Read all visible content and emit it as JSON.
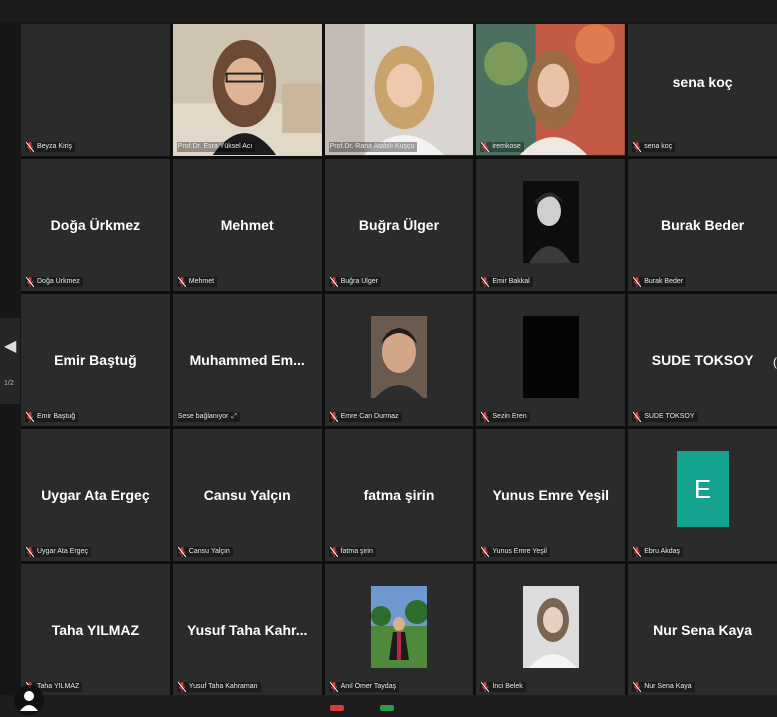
{
  "meeting": {
    "page_indicator": "1/2",
    "colors": {
      "active_border": "#d9e56a",
      "tile_bg": "#2b2b2b",
      "mic_red": "#d83b3b",
      "avatar_teal": "#14a38f"
    }
  },
  "participants": [
    {
      "id": "p1",
      "display": "",
      "label": "Beyza Kiriş",
      "type": "blank"
    },
    {
      "id": "p2",
      "display": "",
      "label": "Prof.Dr. Esra Yüksel Acı",
      "type": "video"
    },
    {
      "id": "p3",
      "display": "",
      "label": "Prof.Dr. Rana Atabilı Kuşçu",
      "type": "video"
    },
    {
      "id": "p4",
      "display": "",
      "label": "iremkose",
      "type": "video"
    },
    {
      "id": "p5",
      "display": "sena koç",
      "label": "sena koç",
      "type": "name"
    },
    {
      "id": "p6",
      "display": "Doğa Ürkmez",
      "label": "Doğa Ürkmez",
      "type": "name"
    },
    {
      "id": "p7",
      "display": "Mehmet",
      "label": "Mehmet",
      "type": "name"
    },
    {
      "id": "p8",
      "display": "Buğra Ülger",
      "label": "Buğra Ülger",
      "type": "name"
    },
    {
      "id": "p9",
      "display": "",
      "label": "Emir Bakkal",
      "type": "photo"
    },
    {
      "id": "p10",
      "display": "Burak Beder",
      "label": "Burak Beder",
      "type": "name"
    },
    {
      "id": "p11",
      "display": "Emir Baştuğ",
      "label": "Emir Baştuğ",
      "type": "name"
    },
    {
      "id": "p12",
      "display": "Muhammed Em...",
      "label": "Sese bağlanıyor",
      "type": "name"
    },
    {
      "id": "p13",
      "display": "",
      "label": "Emre Can Durmaz",
      "type": "photo"
    },
    {
      "id": "p14",
      "display": "",
      "label": "Sezin Eren",
      "type": "photo"
    },
    {
      "id": "p15",
      "display": "SUDE TOKSOY",
      "label": "SUDE TOKSOY",
      "type": "name"
    },
    {
      "id": "p16",
      "display": "Uygar Ata Ergeç",
      "label": "Uygar Ata Ergeç",
      "type": "name"
    },
    {
      "id": "p17",
      "display": "Cansu Yalçın",
      "label": "Cansu Yalçın",
      "type": "name"
    },
    {
      "id": "p18",
      "display": "fatma şirin",
      "label": "fatma şirin",
      "type": "name"
    },
    {
      "id": "p19",
      "display": "Yunus Emre Yeşil",
      "label": "Yunus Emre Yeşil",
      "type": "name"
    },
    {
      "id": "p20",
      "display": "E",
      "label": "Ebru Akdaş",
      "type": "avatar"
    },
    {
      "id": "p21",
      "display": "Taha YILMAZ",
      "label": "Taha YILMAZ",
      "type": "name"
    },
    {
      "id": "p22",
      "display": "Yusuf Taha Kahr...",
      "label": "Yusuf Taha Kahraman",
      "type": "name"
    },
    {
      "id": "p23",
      "display": "",
      "label": "Anıl Ömer Taydaş",
      "type": "photo"
    },
    {
      "id": "p24",
      "display": "",
      "label": "İnci Belek",
      "type": "photo"
    },
    {
      "id": "p25",
      "display": "Nur Sena Kaya",
      "label": "Nur Sena Kaya",
      "type": "name"
    }
  ]
}
